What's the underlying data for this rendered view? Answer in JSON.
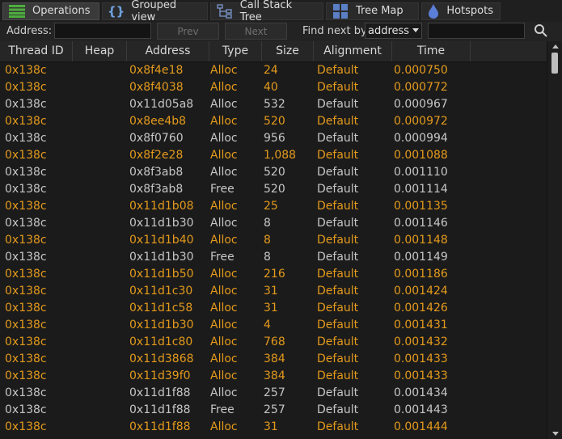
{
  "colors": {
    "highlight": "#e49a1c",
    "normal": "#c6c6c6",
    "background": "#1b1b1b"
  },
  "tabs": [
    {
      "label": "Operations",
      "icon": "list-icon",
      "active": true
    },
    {
      "label": "Grouped view",
      "icon": "braces-icon",
      "active": false
    },
    {
      "label": "Call Stack Tree",
      "icon": "tree-icon",
      "active": false
    },
    {
      "label": "Tree Map",
      "icon": "treemap-icon",
      "active": false
    },
    {
      "label": "Hotspots",
      "icon": "flame-icon",
      "active": false
    }
  ],
  "toolbar": {
    "address_label": "Address:",
    "address_value": "",
    "prev_label": "Prev",
    "next_label": "Next",
    "find_next_label": "Find next by",
    "find_by_selected": "address",
    "search_value": ""
  },
  "table": {
    "columns": [
      "Thread ID",
      "Heap",
      "Address",
      "Type",
      "Size",
      "Alignment",
      "Time"
    ],
    "rows": [
      {
        "thread": "0x138c",
        "heap": "",
        "address": "0x8f4e18",
        "type": "Alloc",
        "size": "24",
        "alignment": "Default",
        "time": "0.000750",
        "highlight": true
      },
      {
        "thread": "0x138c",
        "heap": "",
        "address": "0x8f4038",
        "type": "Alloc",
        "size": "40",
        "alignment": "Default",
        "time": "0.000772",
        "highlight": true
      },
      {
        "thread": "0x138c",
        "heap": "",
        "address": "0x11d05a8",
        "type": "Alloc",
        "size": "532",
        "alignment": "Default",
        "time": "0.000967",
        "highlight": false
      },
      {
        "thread": "0x138c",
        "heap": "",
        "address": "0x8ee4b8",
        "type": "Alloc",
        "size": "520",
        "alignment": "Default",
        "time": "0.000972",
        "highlight": true
      },
      {
        "thread": "0x138c",
        "heap": "",
        "address": "0x8f0760",
        "type": "Alloc",
        "size": "956",
        "alignment": "Default",
        "time": "0.000994",
        "highlight": false
      },
      {
        "thread": "0x138c",
        "heap": "",
        "address": "0x8f2e28",
        "type": "Alloc",
        "size": "1,088",
        "alignment": "Default",
        "time": "0.001088",
        "highlight": true
      },
      {
        "thread": "0x138c",
        "heap": "",
        "address": "0x8f3ab8",
        "type": "Alloc",
        "size": "520",
        "alignment": "Default",
        "time": "0.001110",
        "highlight": false
      },
      {
        "thread": "0x138c",
        "heap": "",
        "address": "0x8f3ab8",
        "type": "Free",
        "size": "520",
        "alignment": "Default",
        "time": "0.001114",
        "highlight": false
      },
      {
        "thread": "0x138c",
        "heap": "",
        "address": "0x11d1b08",
        "type": "Alloc",
        "size": "25",
        "alignment": "Default",
        "time": "0.001135",
        "highlight": true
      },
      {
        "thread": "0x138c",
        "heap": "",
        "address": "0x11d1b30",
        "type": "Alloc",
        "size": "8",
        "alignment": "Default",
        "time": "0.001146",
        "highlight": false
      },
      {
        "thread": "0x138c",
        "heap": "",
        "address": "0x11d1b40",
        "type": "Alloc",
        "size": "8",
        "alignment": "Default",
        "time": "0.001148",
        "highlight": true
      },
      {
        "thread": "0x138c",
        "heap": "",
        "address": "0x11d1b30",
        "type": "Free",
        "size": "8",
        "alignment": "Default",
        "time": "0.001149",
        "highlight": false
      },
      {
        "thread": "0x138c",
        "heap": "",
        "address": "0x11d1b50",
        "type": "Alloc",
        "size": "216",
        "alignment": "Default",
        "time": "0.001186",
        "highlight": true
      },
      {
        "thread": "0x138c",
        "heap": "",
        "address": "0x11d1c30",
        "type": "Alloc",
        "size": "31",
        "alignment": "Default",
        "time": "0.001424",
        "highlight": true
      },
      {
        "thread": "0x138c",
        "heap": "",
        "address": "0x11d1c58",
        "type": "Alloc",
        "size": "31",
        "alignment": "Default",
        "time": "0.001426",
        "highlight": true
      },
      {
        "thread": "0x138c",
        "heap": "",
        "address": "0x11d1b30",
        "type": "Alloc",
        "size": "4",
        "alignment": "Default",
        "time": "0.001431",
        "highlight": true
      },
      {
        "thread": "0x138c",
        "heap": "",
        "address": "0x11d1c80",
        "type": "Alloc",
        "size": "768",
        "alignment": "Default",
        "time": "0.001432",
        "highlight": true
      },
      {
        "thread": "0x138c",
        "heap": "",
        "address": "0x11d3868",
        "type": "Alloc",
        "size": "384",
        "alignment": "Default",
        "time": "0.001433",
        "highlight": true
      },
      {
        "thread": "0x138c",
        "heap": "",
        "address": "0x11d39f0",
        "type": "Alloc",
        "size": "384",
        "alignment": "Default",
        "time": "0.001433",
        "highlight": true
      },
      {
        "thread": "0x138c",
        "heap": "",
        "address": "0x11d1f88",
        "type": "Alloc",
        "size": "257",
        "alignment": "Default",
        "time": "0.001434",
        "highlight": false
      },
      {
        "thread": "0x138c",
        "heap": "",
        "address": "0x11d1f88",
        "type": "Free",
        "size": "257",
        "alignment": "Default",
        "time": "0.001443",
        "highlight": false
      },
      {
        "thread": "0x138c",
        "heap": "",
        "address": "0x11d1f88",
        "type": "Alloc",
        "size": "31",
        "alignment": "Default",
        "time": "0.001444",
        "highlight": true
      }
    ]
  }
}
